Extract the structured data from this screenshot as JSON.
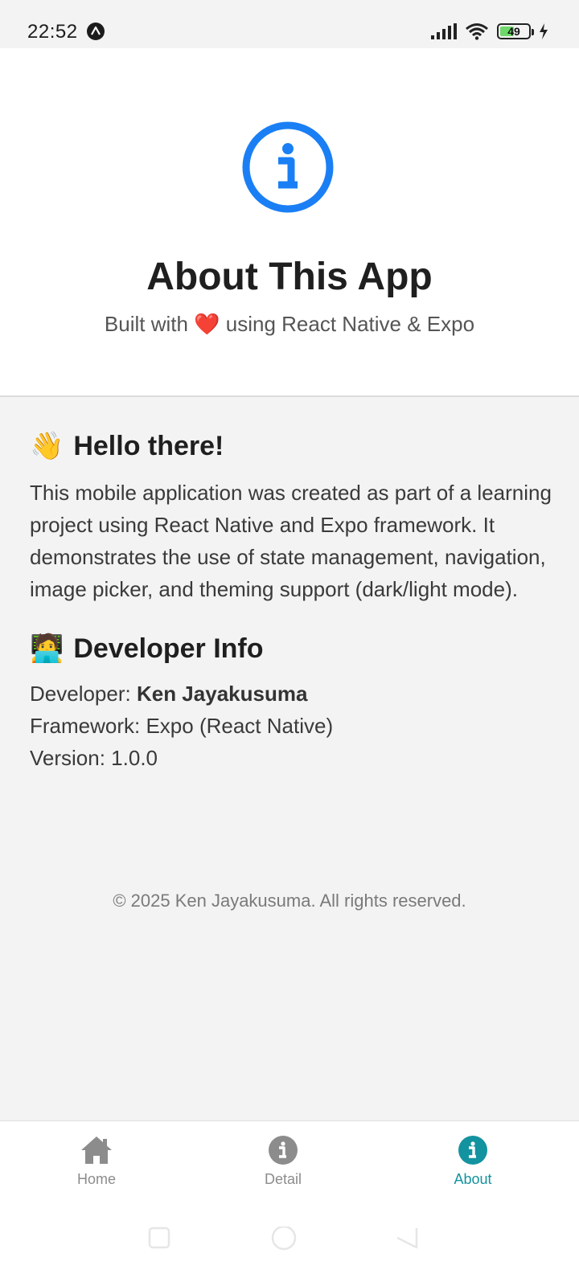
{
  "status_bar": {
    "time": "22:52",
    "app_icon": "expo-icon",
    "icons": [
      "signal-icon",
      "wifi-icon",
      "battery-icon",
      "charging-icon"
    ],
    "battery_level": "49"
  },
  "header": {
    "icon": "info-circle-icon",
    "title": "About This App",
    "subtitle": "Built with ❤️ using React Native & Expo"
  },
  "intro": {
    "emoji": "👋",
    "title": "Hello there!",
    "text": "This mobile application was created as part of a learning project using React Native and Expo framework. It demonstrates the use of state management, navigation, image picker, and theming support (dark/light mode)."
  },
  "developer": {
    "emoji": "🧑‍💻",
    "title": "Developer Info",
    "developer_label": "Developer: ",
    "developer_name": "Ken Jayakusuma",
    "framework": "Framework: Expo (React Native)",
    "version": "Version: 1.0.0"
  },
  "footer": {
    "copyright": "© 2025 Ken Jayakusuma. All rights reserved."
  },
  "tabs": [
    {
      "label": "Home",
      "icon": "home-icon",
      "active": false
    },
    {
      "label": "Detail",
      "icon": "info-icon",
      "active": false
    },
    {
      "label": "About",
      "icon": "info-icon",
      "active": true
    }
  ],
  "colors": {
    "accent": "#13939f",
    "info_blue": "#1a7ff5",
    "inactive": "#8c8c8c"
  }
}
